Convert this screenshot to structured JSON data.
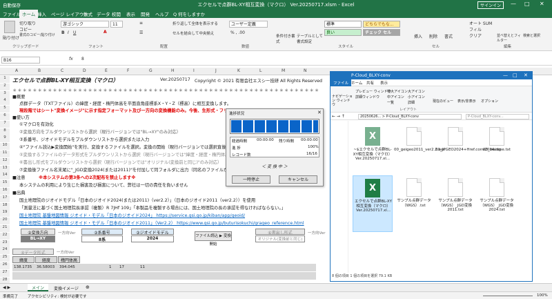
{
  "excel": {
    "quick_access": "自動保存",
    "title": "エクセルで点群BL-XY相互変換（マクロ） Ver.20250717.xlsm - Excel",
    "signin": "サインイン",
    "tabs": [
      "ファイル",
      "ホーム",
      "挿入",
      "ページ レイアウト",
      "数式",
      "データ",
      "校閲",
      "表示",
      "開発",
      "ヘルプ",
      "Q 何をしますか"
    ],
    "ribbon": {
      "paste": "貼り付け",
      "cut": "切り取り",
      "copy": "コピー",
      "format_paint": "書式のコピー/貼り付け",
      "clipboard": "クリップボード",
      "font_name": "游ゴシック",
      "font_size": "11",
      "font": "フォント",
      "wrap": "折り返して全体を表示する",
      "merge": "セルを結合して中央揃え",
      "alignment": "配置",
      "number_format": "ユーザー定義",
      "number": "数値",
      "cond_format": "条件付き書式",
      "table_format": "テーブルとして書式設定",
      "styles": "スタイル",
      "style_standard": "標準",
      "style_bad": "どちらでもな...",
      "style_good": "良い",
      "style_check": "チェック セル",
      "insert": "挿入",
      "delete": "削除",
      "format": "書式",
      "cells": "セル",
      "autosum": "オート SUM",
      "fill": "フィル",
      "clear": "クリア",
      "sort": "並べ替えとフィルター",
      "find": "検索と選択",
      "editing": "編集"
    },
    "formula": {
      "name_box": "B16",
      "fx": "fx",
      "value": "8"
    },
    "columns": [
      "A",
      "B",
      "C",
      "D",
      "E",
      "F",
      "G",
      "H",
      "I",
      "J",
      "K",
      "L",
      "M",
      "N",
      "O",
      "P",
      "Q",
      "R",
      "S",
      "T",
      "U",
      "V",
      "W"
    ],
    "rows": [
      "1",
      "2",
      "3",
      "4",
      "5",
      "6",
      "7",
      "8",
      "9",
      "10",
      "11",
      "12",
      "13",
      "14",
      "15",
      "16",
      "17",
      "18",
      "19",
      "20",
      "21",
      "22",
      "23",
      "24",
      "25",
      "26",
      "27",
      "28"
    ],
    "sheet": {
      "title": "エクセルで点群BL-XY相互変換（マクロ）",
      "version": "Ver.20250717",
      "copyright": "Copyright © 2021 有限会社エスシー技研 All Rights Reserved",
      "stars": "＊＊＊＊＊＊＊＊＊＊＊＊＊＊＊＊＊＊＊＊＊＊＊＊＊＊＊＊＊＊＊＊＊＊＊＊＊＊＊＊＊＊＊＊＊＊＊＊＊＊＊＊＊＊＊＊＊＊＊＊＊",
      "h_overview": "■概要",
      "overview": "点群データ（TXTファイル）の緯度・経度・楕円体高を平面直角座標系X・Y・Z（標高）に相互変換します。",
      "warning": "現段階ではシート\"変換イメージ\"に示す指定フォーマット及び一方向の変換機能のみ。今後、生形式・フリーフ",
      "h_usage": "■使い方",
      "u1": "①マクロを有効化",
      "u2": "②変換方向をプルダウンリストから選択（現行バージョンでは\"BL→XY\"のみ対応）",
      "u3": "③系番号、ジオイドモデルをプルダウンリストから選択または入力",
      "u4": "④\"ファイル読込▶変換開始\"を実行、変換するファイルを選択。変換の開始（現行バージョンでは選択直後に開始）",
      "u5": "⑤変換するファイルのデータ形式をプルダウンリストから選択（現行バージョンでは\"緯度・経度・楕円体高\"）",
      "u6": "⑥書出し形式をプルダウンリストから選択（現行バージョンでは\"オリジナル(変換前と同じ)\"のみ対応）",
      "u7": "⑦変換後ファイル名末尾に\"_JGD変換2024(または2011)\"を付加して同フォルダに出力（同名のファイルが",
      "h_notes": "■注意",
      "notes_red": "※本システムの第3条への2次配布を禁止します※",
      "notes": "本システムの利用により生じた損害及び損害について、弊社は一切の責任を負いません",
      "h_source": "■出典",
      "s1": "国土地理院のジオイドモデル「日本のジオイド2024(または2011)（ver2.2）」（日本のジオイド2011（ver2.2））を使用",
      "s2": "「測量法に基づく国土地理院長承認（複製）R 7JHf 109」「本製品を複製する場合には、国土地理院の長の承認を得なければならない。」",
      "s3": "国土地理院 基盤地図情報 ジオイド・モデル「日本のジオイド2024」 https://service.gsi.go.jp/kiban/app/geoid/",
      "s4": "国土地理院 基盤地図情報 ジオイド・モデル「日本のジオイド2011」（Ver2.2） https://www.gsi.go.jp/buturisokuchi/grageo_reference.html",
      "l_dir": "②変換方向",
      "dir_val": "BL→XY",
      "only": "一方向Ver",
      "l_zone": "③系番号",
      "zone_val": "8系",
      "l_geoid": "③ジオイドモデル",
      "geoid_val": "2024",
      "btn_load": "ファイル読込 ▶ 変換開始",
      "l_out": "⑥書出し形式",
      "out_val": "オリジナル(変換前と同じ)",
      "only2": "一方向Ver",
      "l_fmt": "④データ形式",
      "fmt_only": "一方向Ver",
      "th_lat": "緯度",
      "th_lon": "経度",
      "th_h": "楕円体高",
      "r27": [
        "138.1735",
        "36.58003",
        "394.045",
        "",
        "",
        "1",
        "",
        "",
        "17",
        "",
        "",
        "",
        "11"
      ]
    },
    "sheet_tabs": [
      "メイン",
      "変換イメージ"
    ],
    "status": {
      "ready": "準備完了",
      "access": "アクセシビリティ: 検討が必要です",
      "zoom": "100%"
    }
  },
  "dialog": {
    "title": "進捗状況",
    "progress": 1.0,
    "row1": [
      "経過時間",
      "00:00:00",
      "残り時間",
      "00:00:00"
    ],
    "row2": [
      "進 捗",
      "100%"
    ],
    "row3": [
      "レコード数",
      "16/16"
    ],
    "converting": "＜ 変 換 中 ＞",
    "pause": "一時停止",
    "cancel": "キャンセル"
  },
  "explorer": {
    "title": "P-Cloud_BLXY-conv",
    "tabs": [
      "ファイル",
      "ホーム",
      "共有",
      "表示"
    ],
    "path": "20250626... > P-Cloud_BLXY-conv",
    "search": "P-Cloud_BLXY-conv...",
    "nav": [
      "ナビゲーション ウィンドウ",
      "プレビュー ウィンドウ",
      "詳細ウィンドウ"
    ],
    "layout_items": [
      "特大アイコン",
      "大アイコン",
      "中アイコン",
      "小アイコン",
      "一覧",
      "詳細"
    ],
    "layout": "レイアウト",
    "current_view": "現在のビュー",
    "show_hide": "表示/非表示",
    "options": "オプション",
    "files": [
      {
        "name": "~$エクセルで点群BL-XY相互変換（マクロ）Ver.20250717.xl...",
        "type": "excel-temp"
      },
      {
        "name": "00_geigeo2011_ver2.2.asc",
        "type": "file"
      },
      {
        "name": "00_JPGEO2024+Href.conv2024.isg",
        "type": "file"
      },
      {
        "name": "00_readme.txt",
        "type": "file"
      },
      {
        "name": "エクセルで点群BL-XY相互変換（マクロ）Ver.20250717.xl...",
        "type": "excel"
      },
      {
        "name": "サンプル点群データ（WGS）.txt",
        "type": "file"
      },
      {
        "name": "サンプル点群データ（WGS）_JGD変換2011.txt",
        "type": "file"
      },
      {
        "name": "サンプル点群データ（WGS）_JGD変換2024.txt",
        "type": "file"
      }
    ],
    "status": "8 個の項目  1 個の項目を選択 79.1 KB"
  },
  "colors": {
    "excel_green": "#217346",
    "explorer_blue": "#1e72bd",
    "progress_blue": "#0a64c8"
  }
}
